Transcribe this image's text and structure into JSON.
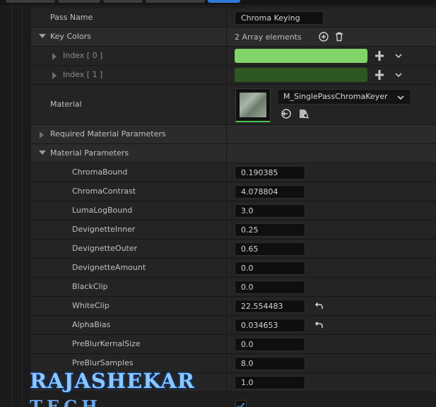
{
  "colors": {
    "keyColor0": "#80d468",
    "keyColor1": "#2f5722",
    "accent": "#2f78d6",
    "selectedOutline": "#4cc44c"
  },
  "pass": {
    "label": "Pass Name",
    "value": "Chroma Keying"
  },
  "keyColors": {
    "label": "Key Colors",
    "summary": "2 Array elements"
  },
  "indices": [
    {
      "label": "Index [ 0 ]"
    },
    {
      "label": "Index [ 1 ]"
    }
  ],
  "material": {
    "label": "Material",
    "asset": "M_SinglePassChromaKeyer"
  },
  "requiredParams": {
    "label": "Required Material Parameters"
  },
  "materialParams": {
    "label": "Material Parameters",
    "items": [
      {
        "name": "ChromaBound",
        "value": "0.190385"
      },
      {
        "name": "ChromaContrast",
        "value": "4.078804"
      },
      {
        "name": "LumaLogBound",
        "value": "3.0"
      },
      {
        "name": "DevignetteInner",
        "value": "0.25"
      },
      {
        "name": "DevignetteOuter",
        "value": "0.65"
      },
      {
        "name": "DevignetteAmount",
        "value": "0.0"
      },
      {
        "name": "BlackClip",
        "value": "0.0"
      },
      {
        "name": "WhiteClip",
        "value": "22.554483"
      },
      {
        "name": "AlphaBias",
        "value": "0.034653"
      },
      {
        "name": "PreBlurKernalSize",
        "value": "0.0"
      },
      {
        "name": "PreBlurSamples",
        "value": "8.0"
      },
      {
        "name": "",
        "value": "1.0"
      }
    ]
  },
  "watermark": {
    "line1": "RAJASHEKAR",
    "line2": "TECH"
  },
  "icons": [
    "add-element-icon",
    "delete-icon",
    "reset-to-default-icon",
    "browse-asset-icon",
    "use-selected-icon",
    "chevron-down-icon",
    "drag-handle-icon",
    "check-icon"
  ]
}
